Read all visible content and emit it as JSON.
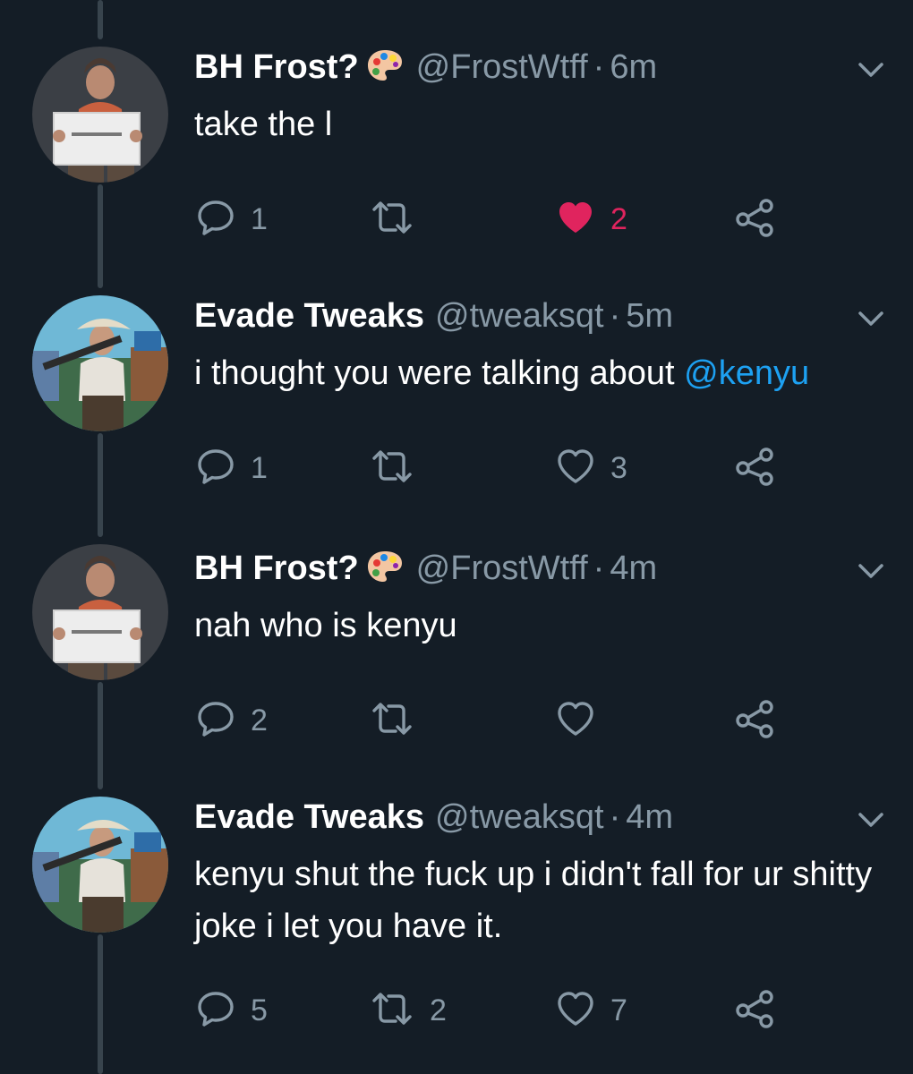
{
  "tweets": [
    {
      "display_name": "BH Frost?",
      "has_emoji": true,
      "emoji": "palette-icon",
      "handle": "@FrostWtff",
      "time": "6m",
      "text_parts": [
        {
          "text": "take the l",
          "mention": false
        }
      ],
      "replies": "1",
      "retweets": "",
      "likes": "2",
      "liked": true
    },
    {
      "display_name": "Evade Tweaks",
      "has_emoji": false,
      "handle": "@tweaksqt",
      "time": "5m",
      "text_parts": [
        {
          "text": "i thought you were talking about ",
          "mention": false
        },
        {
          "text": "@kenyu",
          "mention": true
        }
      ],
      "replies": "1",
      "retweets": "",
      "likes": "3",
      "liked": false
    },
    {
      "display_name": "BH Frost?",
      "has_emoji": true,
      "emoji": "palette-icon",
      "handle": "@FrostWtff",
      "time": "4m",
      "text_parts": [
        {
          "text": "nah who is kenyu",
          "mention": false
        }
      ],
      "replies": "2",
      "retweets": "",
      "likes": "",
      "liked": false
    },
    {
      "display_name": "Evade Tweaks",
      "has_emoji": false,
      "handle": "@tweaksqt",
      "time": "4m",
      "text_parts": [
        {
          "text": "kenyu shut the fuck up i didn't fall for ur shitty joke i let you have it.",
          "mention": false
        }
      ],
      "replies": "5",
      "retweets": "2",
      "likes": "7",
      "liked": false
    }
  ],
  "separator": "·",
  "colors": {
    "background": "#141d26",
    "thread_line": "#38444d",
    "secondary_text": "#8899a6",
    "mention": "#1da1f2",
    "like_active": "#e0245e"
  }
}
